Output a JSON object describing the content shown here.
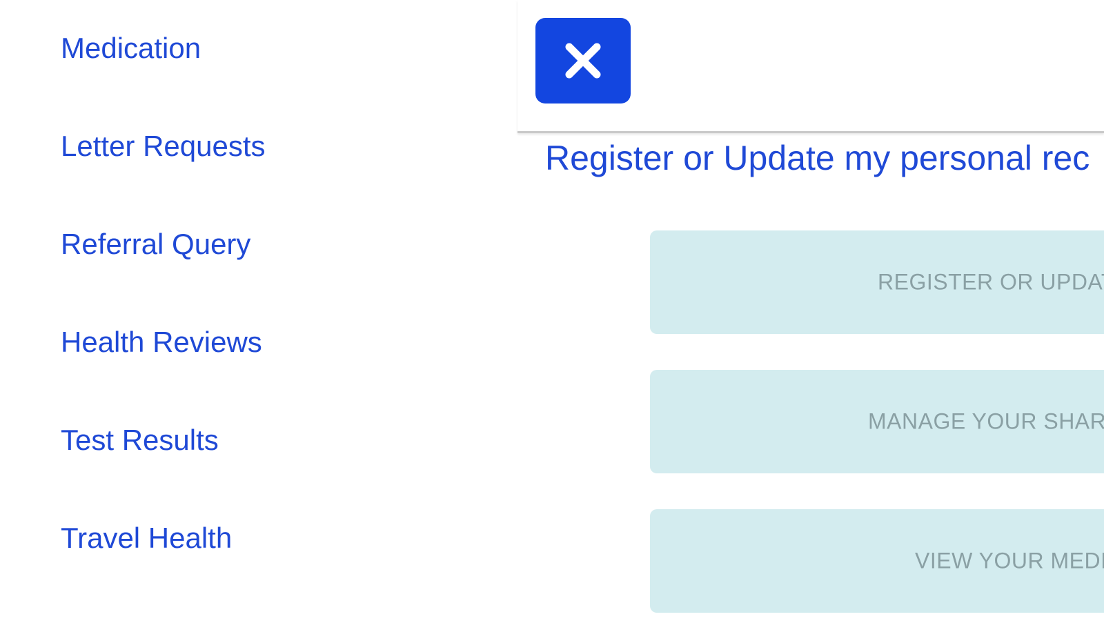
{
  "menu": {
    "items": [
      {
        "label": "Medication"
      },
      {
        "label": "Letter Requests"
      },
      {
        "label": "Referral Query"
      },
      {
        "label": "Health Reviews"
      },
      {
        "label": "Test Results"
      },
      {
        "label": "Travel Health"
      }
    ]
  },
  "panel": {
    "close_icon": "close-icon",
    "title": "Register or Update my personal rec",
    "buttons": [
      {
        "label": "REGISTER OR UPDATE"
      },
      {
        "label": "MANAGE YOUR SHARE"
      },
      {
        "label": "VIEW YOUR MEDIC"
      }
    ]
  },
  "colors": {
    "link": "#1f49d6",
    "close_button": "#1346e0",
    "action_button_bg": "#d3ecef",
    "action_button_text": "#8aa0a4"
  }
}
